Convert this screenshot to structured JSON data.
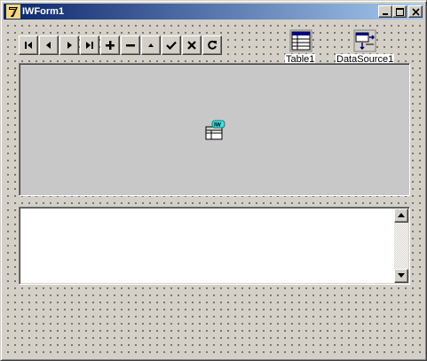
{
  "window": {
    "title": "IWForm1"
  },
  "navigator": {
    "buttons": [
      {
        "name": "first",
        "icon": "first-record-icon"
      },
      {
        "name": "prior",
        "icon": "prior-record-icon"
      },
      {
        "name": "next",
        "icon": "next-record-icon"
      },
      {
        "name": "last",
        "icon": "last-record-icon"
      },
      {
        "name": "insert",
        "icon": "plus-icon"
      },
      {
        "name": "delete",
        "icon": "minus-icon"
      },
      {
        "name": "edit",
        "icon": "triangle-up-icon"
      },
      {
        "name": "post",
        "icon": "checkmark-icon"
      },
      {
        "name": "cancel",
        "icon": "x-icon"
      },
      {
        "name": "refresh",
        "icon": "refresh-icon"
      }
    ]
  },
  "components": {
    "table_label": "Table1",
    "datasource_label": "DataSource1"
  },
  "grid": {
    "icon_text": "IW"
  },
  "colors": {
    "title_start": "#0a246a",
    "title_end": "#a6caf0",
    "face": "#d4d0c8",
    "grid_bg": "#c8c8c8"
  }
}
